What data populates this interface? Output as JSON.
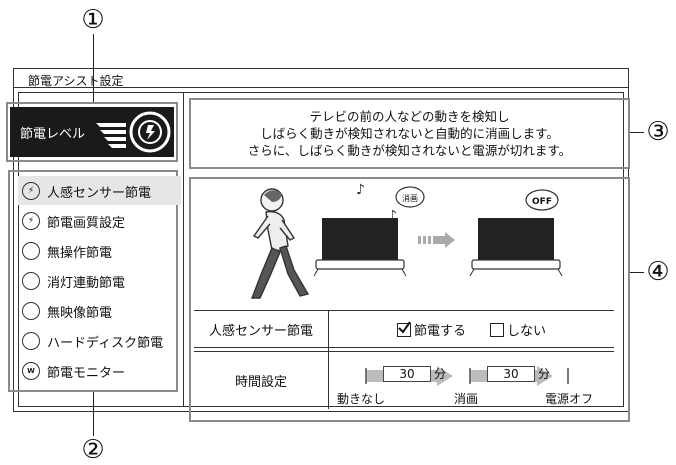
{
  "callouts": {
    "c1": "①",
    "c2": "②",
    "c3": "③",
    "c4": "④"
  },
  "window": {
    "title": "節電アシスト設定"
  },
  "power_level": {
    "label": "節電レベル"
  },
  "menu": {
    "items": [
      {
        "label": "人感センサー節電",
        "icon": "power-leaf-icon",
        "selected": true
      },
      {
        "label": "節電画質設定",
        "icon": "power-leaf-icon",
        "selected": false
      },
      {
        "label": "無操作節電",
        "icon": "empty-circle-icon",
        "selected": false
      },
      {
        "label": "消灯連動節電",
        "icon": "empty-circle-icon",
        "selected": false
      },
      {
        "label": "無映像節電",
        "icon": "empty-circle-icon",
        "selected": false
      },
      {
        "label": "ハードディスク節電",
        "icon": "empty-circle-icon",
        "selected": false
      },
      {
        "label": "節電モニター",
        "icon": "watt-icon",
        "selected": false
      }
    ]
  },
  "description": {
    "line1": "テレビの前の人などの動きを検知し",
    "line2": "しばらく動きが検知されないと自動的に消画します。",
    "line3": "さらに、しばらく動きが検知されないと電源が切れます。"
  },
  "illustration": {
    "bubble_left": "消画",
    "bubble_right": "OFF"
  },
  "settings": {
    "sensor_row_label": "人感センサー節電",
    "option_on": "節電する",
    "option_off": "しない",
    "option_on_checked": true,
    "time_row_label": "時間設定",
    "time1": "30",
    "time2": "30",
    "unit": "分",
    "stage1": "動きなし",
    "stage2": "消画",
    "stage3": "電源オフ"
  }
}
